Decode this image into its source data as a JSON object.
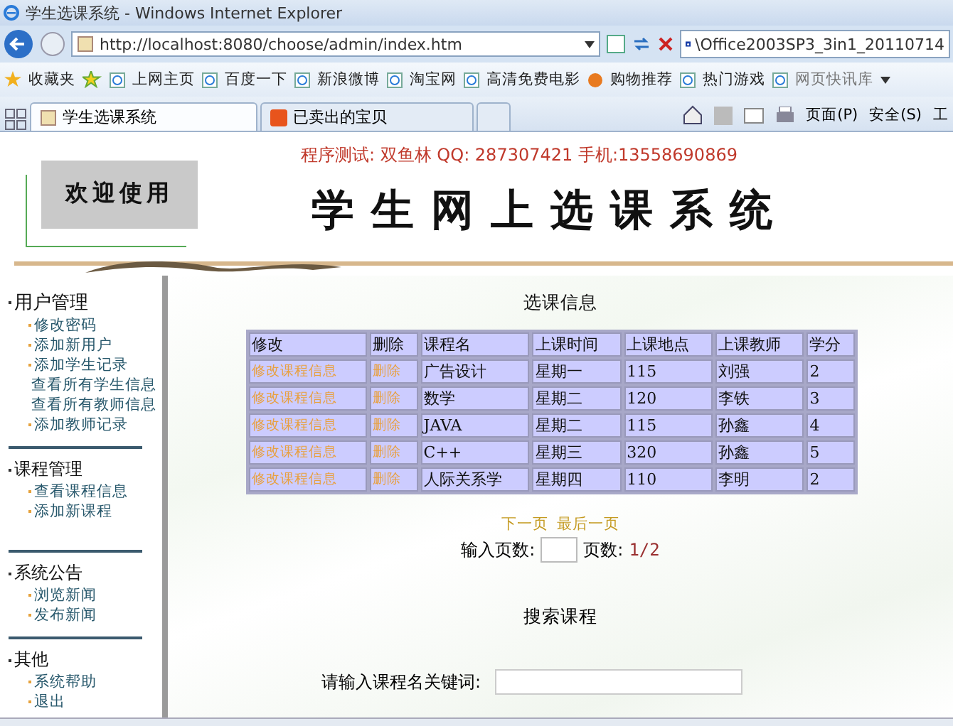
{
  "window": {
    "title": "学生选课系统 - Windows Internet Explorer"
  },
  "address_bar": {
    "url": "http://localhost:8080/choose/admin/index.htm",
    "search_text": "\\Office2003SP3_3in1_20110714"
  },
  "favorites_bar": {
    "label": "收藏夹",
    "links": [
      "上网主页",
      "百度一下",
      "新浪微博",
      "淘宝网",
      "高清免费电影",
      "购物推荐",
      "热门游戏",
      "网页快讯库"
    ]
  },
  "tabs": [
    {
      "label": "学生选课系统",
      "selected": true
    },
    {
      "label": "已卖出的宝贝",
      "selected": false
    }
  ],
  "command_bar": [
    "页面(P)",
    "安全(S)",
    "工"
  ],
  "header": {
    "contact": "程序测试: 双鱼林 QQ: 287307421 手机:13558690869",
    "welcome": "欢迎使用",
    "title": "学生网上选课系统"
  },
  "sidebar": [
    {
      "title": "用户管理",
      "items": [
        "修改密码",
        "添加新用户",
        "添加学生记录",
        "查看所有学生信息",
        "查看所有教师信息",
        "添加教师记录"
      ]
    },
    {
      "title": "课程管理",
      "items": [
        "查看课程信息",
        "添加新课程"
      ]
    },
    {
      "title": "系统公告",
      "items": [
        "浏览新闻",
        "发布新闻"
      ]
    },
    {
      "title": "其他",
      "items": [
        "系统帮助",
        "退出"
      ]
    }
  ],
  "table": {
    "title": "选课信息",
    "columns": [
      "修改",
      "删除",
      "课程名",
      "上课时间",
      "上课地点",
      "上课教师",
      "学分"
    ],
    "rows": [
      {
        "cells": [
          "修改课程信息",
          "删除",
          "广告设计",
          "星期一",
          "115",
          "刘强",
          "2"
        ]
      },
      {
        "cells": [
          "修改课程信息",
          "删除",
          "数学",
          "星期二",
          "120",
          "李铁",
          "3"
        ]
      },
      {
        "cells": [
          "修改课程信息",
          "删除",
          "JAVA",
          "星期二",
          "115",
          "孙鑫",
          "4"
        ]
      },
      {
        "cells": [
          "修改课程信息",
          "删除",
          "C++",
          "星期三",
          "320",
          "孙鑫",
          "5"
        ]
      },
      {
        "cells": [
          "修改课程信息",
          "删除",
          "人际关系学",
          "星期四",
          "110",
          "李明",
          "2"
        ]
      }
    ]
  },
  "pager": {
    "links": [
      "下一页",
      "最后一页"
    ],
    "input_label": "输入页数:",
    "page_label": "页数:",
    "page_value": "1/2"
  },
  "search": {
    "title": "搜索课程",
    "keyword_label": "请输入课程名关键词:"
  }
}
